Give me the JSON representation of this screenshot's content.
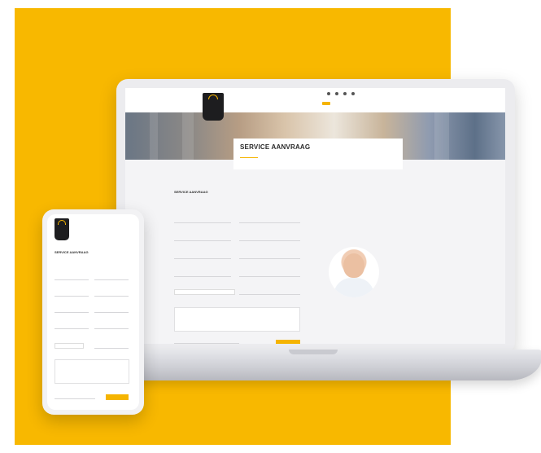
{
  "colors": {
    "brand_yellow": "#f8b800",
    "dark": "#1d1d1f"
  },
  "laptop": {
    "logo_text": "",
    "topbar_items": [
      "",
      "",
      "",
      "",
      ""
    ],
    "nav_items": [
      "",
      "",
      "",
      ""
    ],
    "nav_cta": "",
    "hero_title": "SERVICE AANVRAAG",
    "hero_subtitle": "",
    "breadcrumb": "",
    "form": {
      "title": "SERVICE AANVRAAG",
      "subtitle": "",
      "select_value": "",
      "submit_label": ""
    },
    "right": {
      "title": "",
      "paragraph1": "",
      "paragraph2": "",
      "photo_caption": ""
    }
  },
  "phone": {
    "logo_text": "",
    "menu_label": "",
    "title": "SERVICE AANVRAAG",
    "subtitle": "",
    "select_value": "",
    "submit_label": ""
  }
}
